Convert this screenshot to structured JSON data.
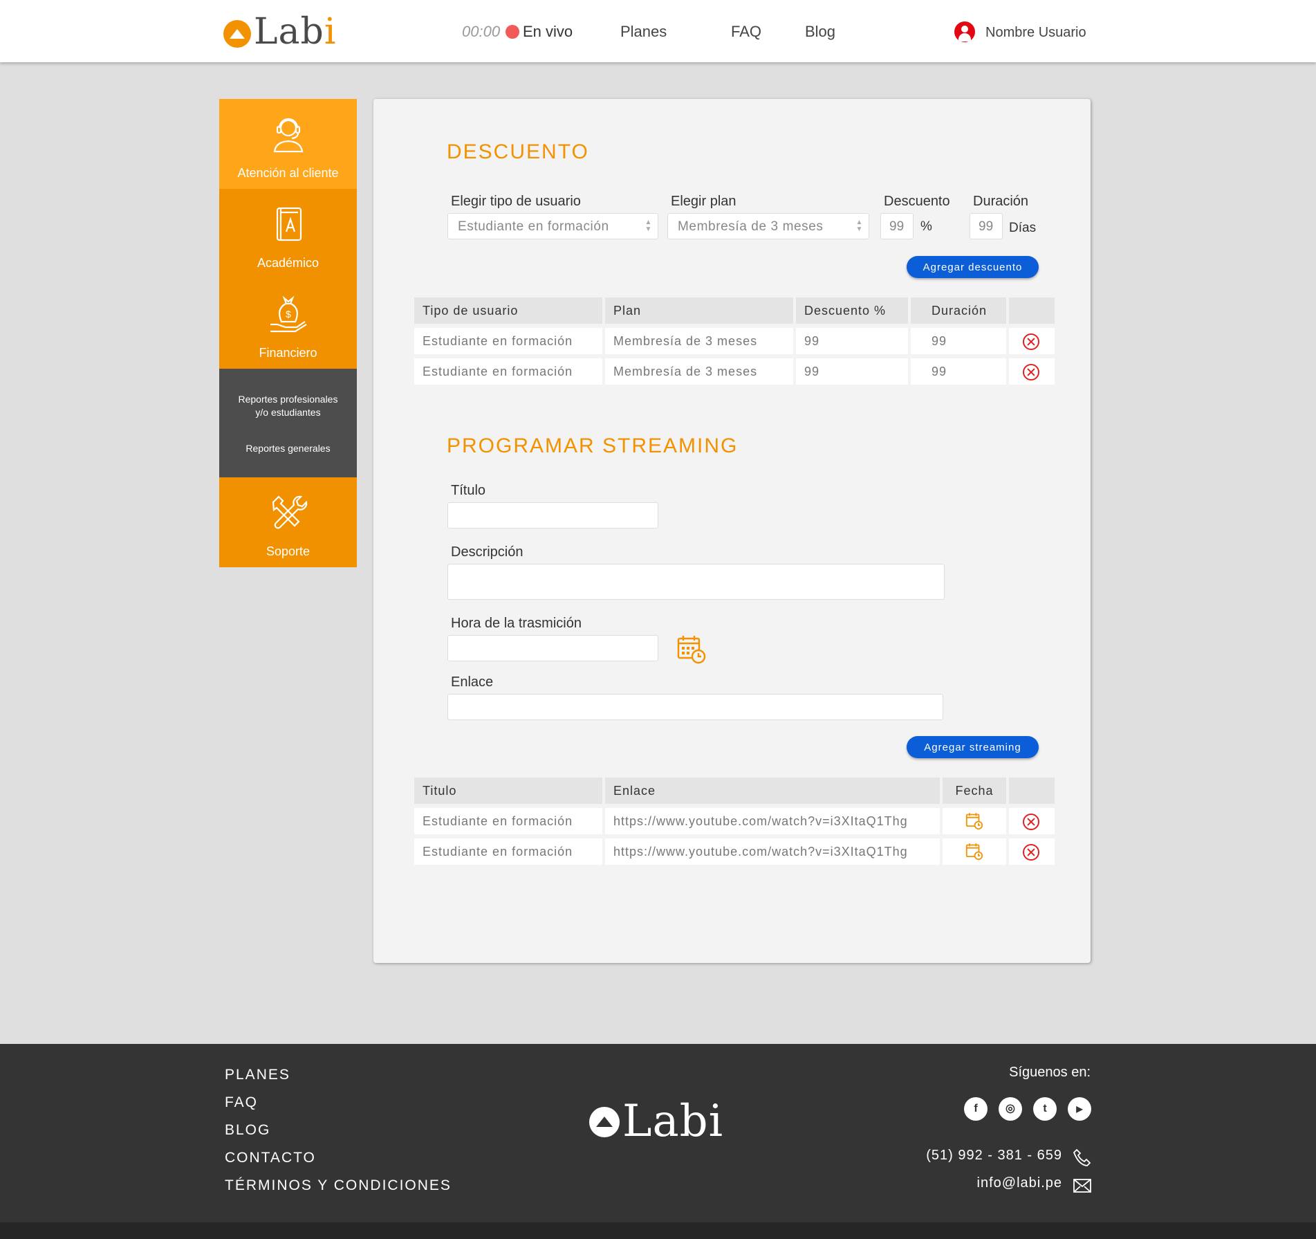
{
  "header": {
    "logo": {
      "main": "Lab",
      "accent": "i"
    },
    "timer": "00:00",
    "live_label": "En vivo",
    "nav": [
      "Planes",
      "FAQ",
      "Blog"
    ],
    "user_name": "Nombre Usuario"
  },
  "sidebar": {
    "items": [
      {
        "label": "Atención al cliente",
        "icon": "headset-agent-icon"
      },
      {
        "label": "Académico",
        "icon": "book-icon"
      },
      {
        "label": "Financiero",
        "icon": "money-hand-icon"
      },
      {
        "label": "Soporte",
        "icon": "tools-icon"
      }
    ],
    "submenu": [
      "Reportes profesionales y/o estudiantes",
      "Reportes generales"
    ]
  },
  "discount": {
    "title": "DESCUENTO",
    "user_type_label": "Elegir tipo de usuario",
    "user_type_value": "Estudiante en formación",
    "plan_label": "Elegir plan",
    "plan_value": "Membresía de 3 meses",
    "discount_label": "Descuento",
    "discount_value": "99",
    "discount_unit": "%",
    "duration_label": "Duración",
    "duration_value": "99",
    "duration_unit": "Días",
    "add_button": "Agregar descuento",
    "table": {
      "headers": [
        "Tipo de usuario",
        "Plan",
        "Descuento %",
        "Duración",
        ""
      ],
      "rows": [
        [
          "Estudiante en formación",
          "Membresía de 3 meses",
          "99",
          "99"
        ],
        [
          "Estudiante en formación",
          "Membresía de 3 meses",
          "99",
          "99"
        ]
      ]
    }
  },
  "streaming": {
    "title": "PROGRAMAR STREAMING",
    "title_label": "Título",
    "description_label": "Descripción",
    "time_label": "Hora de la trasmición",
    "link_label": "Enlace",
    "add_button": "Agregar streaming",
    "table": {
      "headers": [
        "Titulo",
        "Enlace",
        "Fecha",
        ""
      ],
      "rows": [
        [
          "Estudiante en formación",
          "https://www.youtube.com/watch?v=i3XItaQ1Thg"
        ],
        [
          "Estudiante en formación",
          "https://www.youtube.com/watch?v=i3XItaQ1Thg"
        ]
      ]
    }
  },
  "footer": {
    "links": [
      "PLANES",
      "FAQ",
      "BLOG",
      "CONTACTO",
      "TÉRMINOS Y CONDICIONES"
    ],
    "logo": "Labi",
    "follow_label": "Síguenos en:",
    "social": [
      "facebook-icon",
      "instagram-icon",
      "twitter-icon",
      "youtube-icon"
    ],
    "phone": "(51) 992 - 381 - 659",
    "email": "info@labi.pe"
  },
  "colors": {
    "brand_orange": "#f39200",
    "sidebar_active": "#fea519",
    "button_blue": "#0b5ed7",
    "delete_red": "#e02020",
    "footer_bg": "#343434"
  }
}
